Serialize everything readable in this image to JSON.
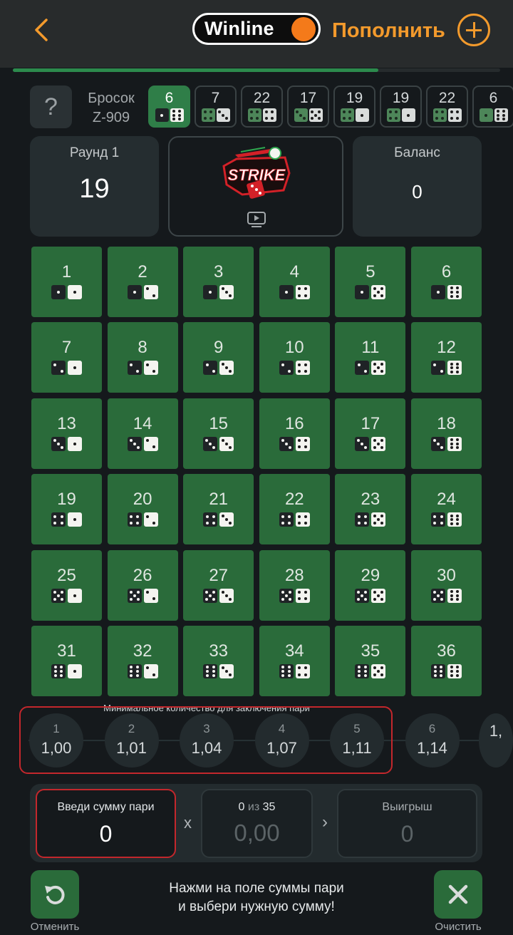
{
  "header": {
    "brand": "Winline",
    "deposit_label": "Пополнить",
    "accent": "#f39a2c",
    "brand_dot": "#f47a1a",
    "icons": [
      "chevron-left-icon",
      "plus-circle-icon"
    ]
  },
  "progress": {
    "fraction": 0.75,
    "color": "#2c8a4d"
  },
  "throw": {
    "label": "Бросок",
    "id": "Z-909"
  },
  "history": [
    {
      "sum": 6,
      "dice": [
        1,
        6
      ],
      "active": true
    },
    {
      "sum": 7,
      "dice": [
        4,
        3
      ]
    },
    {
      "sum": 22,
      "dice": [
        4,
        4
      ]
    },
    {
      "sum": 17,
      "dice": [
        3,
        5
      ]
    },
    {
      "sum": 19,
      "dice": [
        4,
        1
      ]
    },
    {
      "sum": 19,
      "dice": [
        4,
        1
      ]
    },
    {
      "sum": 22,
      "dice": [
        4,
        4
      ]
    },
    {
      "sum": 6,
      "dice": [
        1,
        6
      ]
    }
  ],
  "round": {
    "label": "Раунд 1",
    "value": "19"
  },
  "balance": {
    "label": "Баланс",
    "value": "0"
  },
  "stream": {
    "logo": "STRIKE",
    "icon": "tv-play-icon"
  },
  "grid": {
    "cell_color": "#2a6b3a",
    "cells": [
      {
        "n": "1",
        "d": [
          1,
          1
        ]
      },
      {
        "n": "2",
        "d": [
          1,
          2
        ]
      },
      {
        "n": "3",
        "d": [
          1,
          3
        ]
      },
      {
        "n": "4",
        "d": [
          1,
          4
        ]
      },
      {
        "n": "5",
        "d": [
          1,
          5
        ]
      },
      {
        "n": "6",
        "d": [
          1,
          6
        ]
      },
      {
        "n": "7",
        "d": [
          2,
          1
        ]
      },
      {
        "n": "8",
        "d": [
          2,
          2
        ]
      },
      {
        "n": "9",
        "d": [
          2,
          3
        ]
      },
      {
        "n": "10",
        "d": [
          2,
          4
        ]
      },
      {
        "n": "11",
        "d": [
          2,
          5
        ]
      },
      {
        "n": "12",
        "d": [
          2,
          6
        ]
      },
      {
        "n": "13",
        "d": [
          3,
          1
        ]
      },
      {
        "n": "14",
        "d": [
          3,
          2
        ]
      },
      {
        "n": "15",
        "d": [
          3,
          3
        ]
      },
      {
        "n": "16",
        "d": [
          3,
          4
        ]
      },
      {
        "n": "17",
        "d": [
          3,
          5
        ]
      },
      {
        "n": "18",
        "d": [
          3,
          6
        ]
      },
      {
        "n": "19",
        "d": [
          4,
          1
        ]
      },
      {
        "n": "20",
        "d": [
          4,
          2
        ]
      },
      {
        "n": "21",
        "d": [
          4,
          3
        ]
      },
      {
        "n": "22",
        "d": [
          4,
          4
        ]
      },
      {
        "n": "23",
        "d": [
          4,
          5
        ]
      },
      {
        "n": "24",
        "d": [
          4,
          6
        ]
      },
      {
        "n": "25",
        "d": [
          5,
          1
        ]
      },
      {
        "n": "26",
        "d": [
          5,
          2
        ]
      },
      {
        "n": "27",
        "d": [
          5,
          3
        ]
      },
      {
        "n": "28",
        "d": [
          5,
          4
        ]
      },
      {
        "n": "29",
        "d": [
          5,
          5
        ]
      },
      {
        "n": "30",
        "d": [
          5,
          6
        ]
      },
      {
        "n": "31",
        "d": [
          6,
          1
        ]
      },
      {
        "n": "32",
        "d": [
          6,
          2
        ]
      },
      {
        "n": "33",
        "d": [
          6,
          3
        ]
      },
      {
        "n": "34",
        "d": [
          6,
          4
        ]
      },
      {
        "n": "35",
        "d": [
          6,
          5
        ]
      },
      {
        "n": "36",
        "d": [
          6,
          6
        ]
      }
    ]
  },
  "coefficients": {
    "label": "Минимальное количество для заключения пари",
    "items": [
      {
        "n": "1",
        "v": "1,00"
      },
      {
        "n": "2",
        "v": "1,01"
      },
      {
        "n": "3",
        "v": "1,04"
      },
      {
        "n": "4",
        "v": "1,07"
      },
      {
        "n": "5",
        "v": "1,11"
      },
      {
        "n": "6",
        "v": "1,14"
      },
      {
        "n": "",
        "v": "1,"
      }
    ]
  },
  "bet": {
    "input_label": "Введи сумму пари",
    "input_value": "0",
    "multiply": "x",
    "count_value": "0",
    "count_of": "из",
    "count_total": "35",
    "count_sum": "0,00",
    "arrow": "›",
    "win_label": "Выигрыш",
    "win_value": "0",
    "highlight": "#c3272c"
  },
  "footer": {
    "cancel_label": "Отменить",
    "hint_line1": "Нажми на поле суммы пари",
    "hint_line2": "и выбери нужную сумму!",
    "clear_label": "Очистить",
    "icons": [
      "undo-icon",
      "close-icon"
    ]
  }
}
